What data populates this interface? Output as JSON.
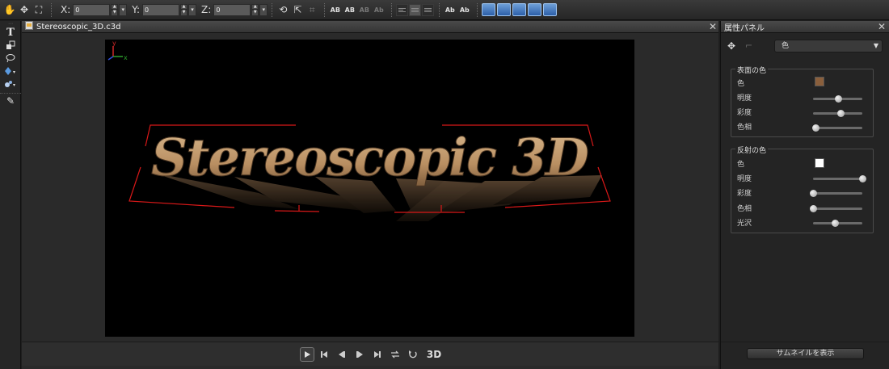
{
  "toolbar": {
    "x_label": "X:",
    "x_value": "0",
    "y_label": "Y:",
    "y_value": "0",
    "z_label": "Z:",
    "z_value": "0",
    "text_btn_1": "AB",
    "text_btn_2": "AB",
    "text_btn_3": "AB",
    "text_btn_4": "Ab",
    "text_btn_5": "Ab"
  },
  "viewport": {
    "tab_title": "Stereoscopic_3D.c3d",
    "axis_y": "y",
    "axis_x": "x",
    "scene_text": "Stereoscopic 3D"
  },
  "playback": {
    "mode_label": "3D"
  },
  "properties": {
    "panel_title": "属性パネル",
    "material_select": "色",
    "surface": {
      "title": "表面の色",
      "rows": [
        {
          "label": "色",
          "swatch": "#8a5f3c"
        },
        {
          "label": "明度",
          "slider": 0.5
        },
        {
          "label": "彩度",
          "slider": 0.56
        },
        {
          "label": "色相",
          "slider": 0.05
        }
      ]
    },
    "reflection": {
      "title": "反射の色",
      "rows": [
        {
          "label": "色",
          "swatch": "#ffffff"
        },
        {
          "label": "明度",
          "slider": 1.0
        },
        {
          "label": "彩度",
          "slider": 0.0
        },
        {
          "label": "色相",
          "slider": 0.0
        },
        {
          "label": "光沢",
          "slider": 0.44
        }
      ]
    },
    "thumbnail_button": "サムネイルを表示"
  },
  "colors": {
    "selection_box": "#d81818",
    "text_face": "#c9a47a"
  }
}
